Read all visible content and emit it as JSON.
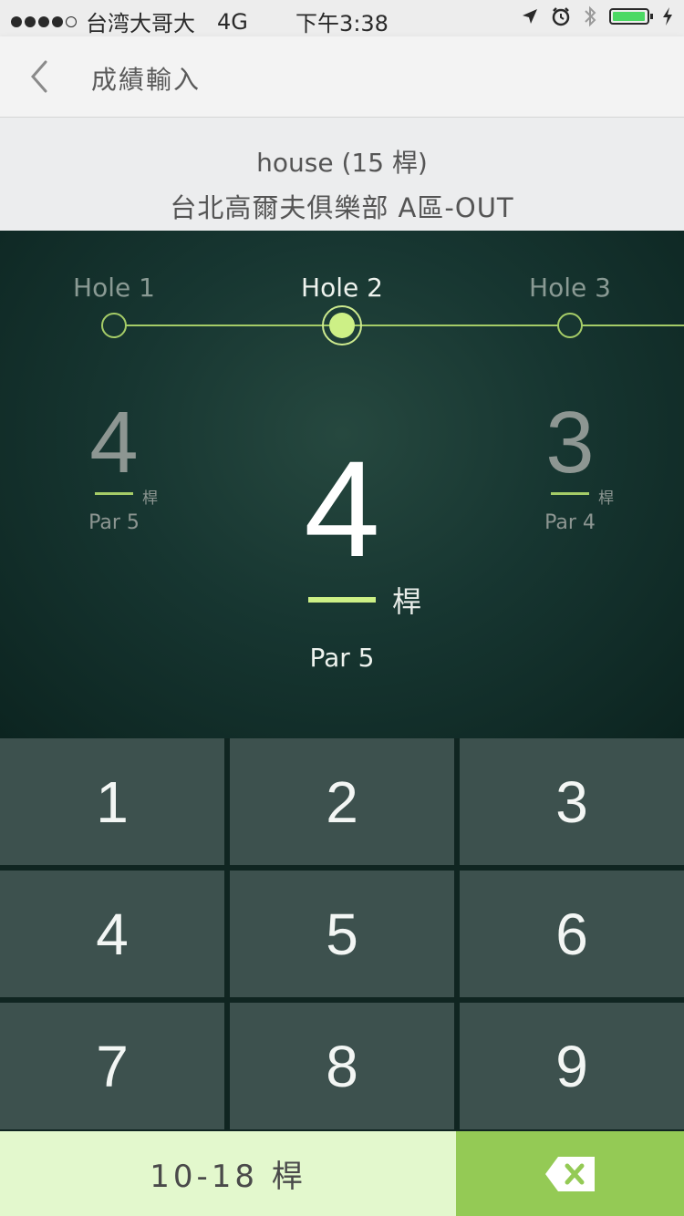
{
  "status_bar": {
    "carrier": "台湾大哥大",
    "network": "4G",
    "time": "下午3:38",
    "icons": [
      "location-arrow-icon",
      "alarm-icon",
      "bluetooth-icon",
      "battery-icon",
      "charging-icon"
    ]
  },
  "nav": {
    "back_icon": "chevron-left-icon",
    "title": "成績輸入"
  },
  "info": {
    "player": "house (15 桿)",
    "course": "台北高爾夫俱樂部 A區-OUT"
  },
  "holes": [
    {
      "label": "Hole 1",
      "score": "4",
      "unit": "桿",
      "par": "Par 5"
    },
    {
      "label": "Hole 2",
      "score": "4",
      "unit": "桿",
      "par": "Par 5"
    },
    {
      "label": "Hole 3",
      "score": "3",
      "unit": "桿",
      "par": "Par 4"
    }
  ],
  "current_hole_index": 1,
  "keypad": {
    "keys": [
      "1",
      "2",
      "3",
      "4",
      "5",
      "6",
      "7",
      "8",
      "9"
    ],
    "range_key": "10-18 桿",
    "delete_icon": "backspace-icon"
  },
  "colors": {
    "accent": "#cdf086",
    "line": "#a5cc67",
    "key_bg": "#3d514e",
    "range_bg": "#e3f8cd",
    "delete_bg": "#94ca55"
  }
}
